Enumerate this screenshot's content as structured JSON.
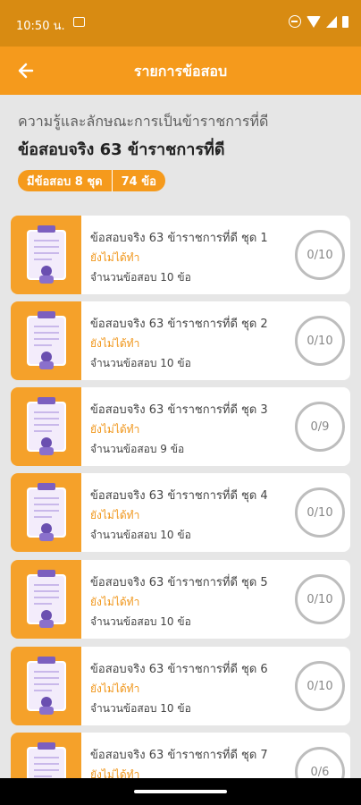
{
  "status_bar": {
    "time": "10:50 น."
  },
  "app_bar": {
    "title": "รายการข้อสอบ"
  },
  "header": {
    "subtitle": "ความรู้และลักษณะการเป็นข้าราชการที่ดี",
    "title": "ข้อสอบจริง 63 ข้าราชการที่ดี",
    "sets_badge": "มีข้อสอบ 8 ชุด",
    "count_badge": "74 ข้อ"
  },
  "exams": [
    {
      "title": "ข้อสอบจริง 63 ข้าราชการที่ดี ชุด 1",
      "status": "ยังไม่ได้ทำ",
      "count": "จำนวนข้อสอบ 10 ข้อ",
      "score": "0/10"
    },
    {
      "title": "ข้อสอบจริง 63 ข้าราชการที่ดี ชุด 2",
      "status": "ยังไม่ได้ทำ",
      "count": "จำนวนข้อสอบ 10 ข้อ",
      "score": "0/10"
    },
    {
      "title": "ข้อสอบจริง 63 ข้าราชการที่ดี ชุด 3",
      "status": "ยังไม่ได้ทำ",
      "count": "จำนวนข้อสอบ 9 ข้อ",
      "score": "0/9"
    },
    {
      "title": "ข้อสอบจริง 63 ข้าราชการที่ดี ชุด 4",
      "status": "ยังไม่ได้ทำ",
      "count": "จำนวนข้อสอบ 10 ข้อ",
      "score": "0/10"
    },
    {
      "title": "ข้อสอบจริง 63 ข้าราชการที่ดี ชุด 5",
      "status": "ยังไม่ได้ทำ",
      "count": "จำนวนข้อสอบ 10 ข้อ",
      "score": "0/10"
    },
    {
      "title": "ข้อสอบจริง 63 ข้าราชการที่ดี ชุด 6",
      "status": "ยังไม่ได้ทำ",
      "count": "จำนวนข้อสอบ 10 ข้อ",
      "score": "0/10"
    },
    {
      "title": "ข้อสอบจริง 63 ข้าราชการที่ดี ชุด 7",
      "status": "ยังไม่ได้ทำ",
      "count": "",
      "score": "0/6"
    }
  ],
  "colors": {
    "accent": "#f59a1c",
    "status_bar": "#d88b12",
    "background": "#e6e6e6",
    "status_text": "#f0961a"
  },
  "icons": {
    "back": "arrow-left-icon",
    "thumbnail": "clipboard-exam-icon"
  }
}
